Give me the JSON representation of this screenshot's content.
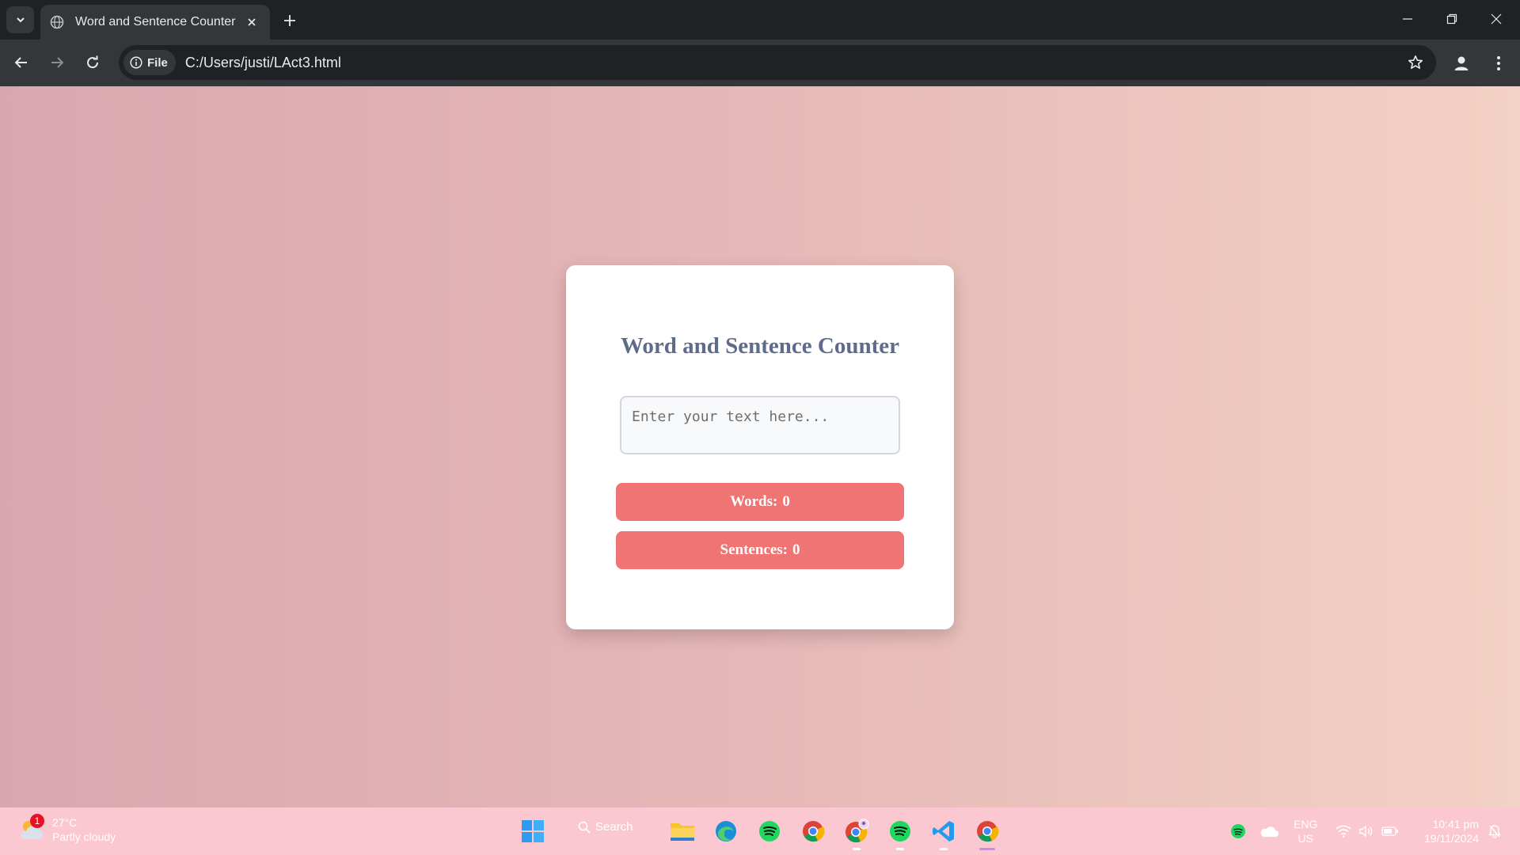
{
  "browser": {
    "tab_title": "Word and Sentence Counter",
    "site_chip_label": "File",
    "url": "C:/Users/justi/LAct3.html"
  },
  "page": {
    "title": "Word and Sentence Counter",
    "textarea_placeholder": "Enter your text here...",
    "words_label": "Words:",
    "words_count": "0",
    "sentences_label": "Sentences:",
    "sentences_count": "0",
    "colors": {
      "button": "#f07474",
      "title": "#5e6b8d",
      "background_start": "#d9a7b0",
      "background_end": "#f2d2c4"
    }
  },
  "taskbar": {
    "weather_temp": "27°C",
    "weather_condition": "Partly cloudy",
    "weather_badge": "1",
    "search_label": "Search",
    "apps": [
      "start-icon",
      "file-explorer-icon",
      "edge-icon",
      "spotify-icon",
      "chrome-icon",
      "chrome-profile-icon",
      "spotify-icon",
      "vscode-icon",
      "chrome-icon"
    ],
    "lang_top": "ENG",
    "lang_bottom": "US",
    "time": "10:41 pm",
    "date": "19/11/2024"
  }
}
